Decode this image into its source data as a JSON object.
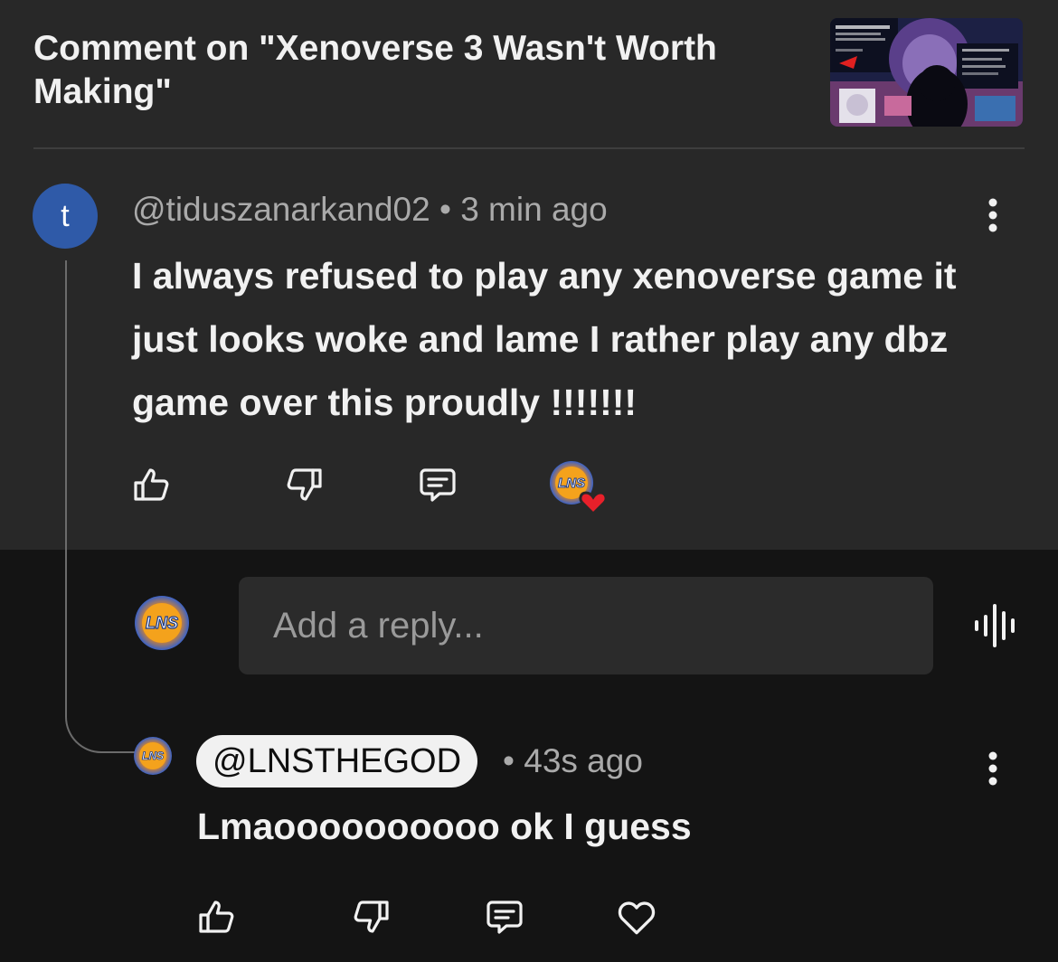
{
  "header": {
    "title": "Comment on \"Xenoverse 3 Wasn't Worth Making\""
  },
  "parent_comment": {
    "avatar_letter": "t",
    "author": "@tiduszanarkand02",
    "separator": "•",
    "time": "3 min ago",
    "text": "I always refused to play any xenoverse game it just looks woke and lame I rather play any dbz game over this proudly !!!!!!!",
    "creator_hearted": true
  },
  "composer": {
    "placeholder": "Add a reply..."
  },
  "reply": {
    "author": "@LNSTHEGOD",
    "separator": "•",
    "time": "43s ago",
    "text": "Lmaoooooooooo ok I guess"
  },
  "channel_avatar": {
    "logo_text": "LNS"
  },
  "icons": {
    "like": "thumbs-up-icon",
    "dislike": "thumbs-down-icon",
    "reply": "comment-icon",
    "heart": "heart-icon",
    "more": "more-vertical-icon",
    "voice": "voice-search-icon"
  },
  "colors": {
    "page_bg": "#141414",
    "panel_bg": "#282828",
    "avatar_t": "#2f5aa8",
    "heart_red": "#e8202a",
    "text_primary": "#f1f1f1",
    "text_secondary": "#aaaaaa"
  }
}
